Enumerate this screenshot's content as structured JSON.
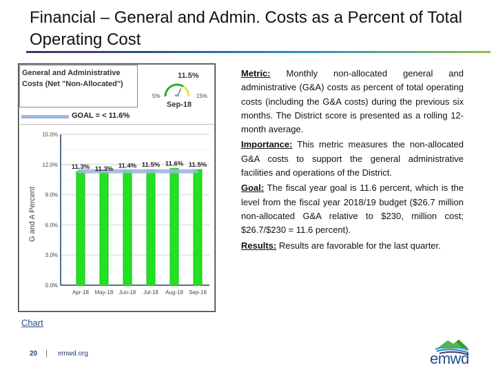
{
  "slide": {
    "title": "Financial – General and Admin. Costs as a Percent of Total Operating Cost",
    "page_number": "20",
    "separator": "|",
    "website": "emwd.org",
    "logo_text": "emwd",
    "chart_link": "Chart"
  },
  "panel": {
    "header_title": "General and Administrative Costs (Net \"Non-Allocated\")",
    "gauge": {
      "value_label": "11.5%",
      "value": 11.5,
      "min_label": "5%",
      "max_label": "15%",
      "min": 5,
      "max": 15,
      "date": "Sep-18"
    },
    "goal_label": "GOAL = < 11.6%",
    "ylabel": "G and A Percent"
  },
  "description": {
    "metric_label": "Metric:",
    "metric_text": " Monthly non-allocated general and administrative (G&A) costs as percent of total operating costs (including the G&A costs) during the previous six months. The District score is presented as a rolling 12-month average.",
    "importance_label": "Importance:",
    "importance_text": " This metric measures the non-allocated G&A costs to support the general administrative facilities and operations of the District.",
    "goal_label": "Goal:",
    "goal_text": " The fiscal year goal is 11.6 percent, which is the level from the fiscal year 2018/19 budget ($26.7 million non-allocated G&A relative to $230, million cost; $26.7/$230 = 11.6 percent).",
    "results_label": "Results:",
    "results_text": " Results are favorable for the last quarter."
  },
  "colors": {
    "bar": "#22e022",
    "goal_line": "#9db8d6",
    "axis": "#1f3f5e",
    "grid": "#e6e6e6"
  },
  "chart_data": {
    "type": "bar",
    "title": "General and Administrative Costs (Net \"Non-Allocated\")",
    "categories": [
      "Apr-18",
      "May-18",
      "Jun-18",
      "Jul-18",
      "Aug-18",
      "Sep-18"
    ],
    "series": [
      {
        "name": "G and A Percent",
        "values": [
          11.3,
          11.3,
          11.4,
          11.5,
          11.6,
          11.5
        ],
        "data_labels": [
          "11.3%",
          "11.3%",
          "11.4%",
          "11.5%",
          "11.6%",
          "11.5%"
        ]
      },
      {
        "name": "GOAL = < 11.6%",
        "type": "line",
        "values": [
          11.6,
          11.6,
          11.6,
          11.6,
          11.6,
          11.6
        ]
      }
    ],
    "xlabel": "",
    "ylabel": "G and A Percent",
    "ylim": [
      0,
      15
    ],
    "yticks": [
      0,
      3,
      6,
      9,
      12,
      15
    ],
    "ytick_labels": [
      "0.0%",
      "3.0%",
      "6.0%",
      "9.0%",
      "12.0%",
      "15.0%"
    ],
    "grid": true,
    "legend": "top-left"
  }
}
